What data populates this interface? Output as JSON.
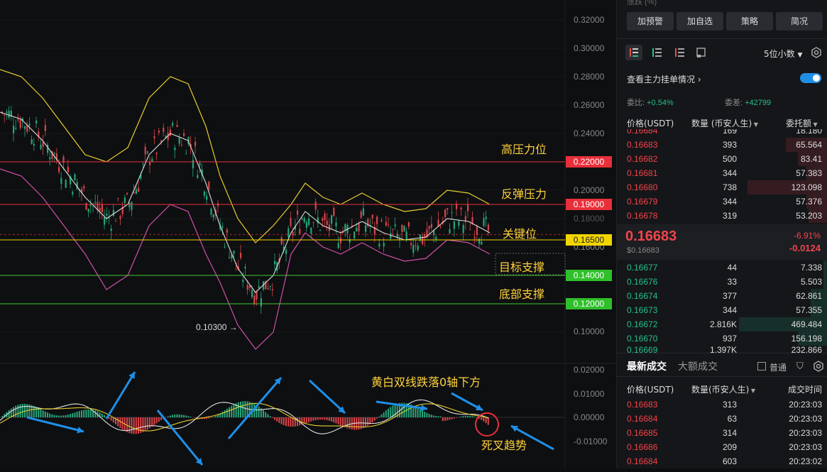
{
  "chart": {
    "price_axis": [
      "0.32000",
      "0.30000",
      "0.28000",
      "0.26000",
      "0.24000",
      "0.20000",
      "0.18000",
      "0.16000",
      "0.10000"
    ],
    "macd_axis": [
      "0.02000",
      "0.01000",
      "0.00000",
      "-0.01000"
    ],
    "levels": [
      {
        "price": "0.22000",
        "label": "高压力位",
        "color": "#e8303a"
      },
      {
        "price": "0.19000",
        "label": "反弹压力",
        "color": "#e8303a"
      },
      {
        "price": "0.16500",
        "label": "关键位",
        "color": "#f2d500"
      },
      {
        "price": "0.14000",
        "label": "目标支撑",
        "color": "#3ecb2f"
      },
      {
        "price": "0.12000",
        "label": "底部支撑",
        "color": "#3ecb2f"
      }
    ],
    "low_label": "0.10300",
    "macd_note": "黄白双线跌落0轴下方",
    "cross_note": "死叉趋势"
  },
  "panel": {
    "top_partial": "涨跌 (%)",
    "buttons": [
      "加预警",
      "加自选",
      "策略",
      "简况"
    ],
    "decimals": "5位小数",
    "depth_link": "查看主力挂单情况",
    "ratio_label": "委比:",
    "ratio_value": "+0.54%",
    "diff_label": "委差:",
    "diff_value": "+42799",
    "headers": {
      "price": "价格(USDT)",
      "qty": "数量 (币安人生)",
      "total": "委托额"
    },
    "asks_partial": {
      "price": "0.16684",
      "qty": "169",
      "total": "18.180"
    },
    "asks": [
      {
        "price": "0.16683",
        "qty": "393",
        "total": "65.564",
        "depth": 0.2
      },
      {
        "price": "0.16682",
        "qty": "500",
        "total": "83.41",
        "depth": 0.14
      },
      {
        "price": "0.16681",
        "qty": "344",
        "total": "57.383",
        "depth": 0.1
      },
      {
        "price": "0.16680",
        "qty": "738",
        "total": "123.098",
        "depth": 0.38
      },
      {
        "price": "0.16679",
        "qty": "344",
        "total": "57.376",
        "depth": 0.1
      },
      {
        "price": "0.16678",
        "qty": "319",
        "total": "53.203",
        "depth": 0.09
      }
    ],
    "last_price": "0.16683",
    "last_usd": "$0.16683",
    "change_pct": "-6.91%",
    "change_abs": "-0.0124",
    "bids": [
      {
        "price": "0.16677",
        "qty": "44",
        "total": "7.338",
        "depth": 0.02
      },
      {
        "price": "0.16676",
        "qty": "33",
        "total": "5.503",
        "depth": 0.02
      },
      {
        "price": "0.16674",
        "qty": "377",
        "total": "62.861",
        "depth": 0.08
      },
      {
        "price": "0.16673",
        "qty": "344",
        "total": "57.355",
        "depth": 0.08
      },
      {
        "price": "0.16672",
        "qty": "2.816K",
        "total": "469.484",
        "depth": 0.42
      },
      {
        "price": "0.16670",
        "qty": "937",
        "total": "156.198",
        "depth": 0.14
      }
    ],
    "bids_partial": {
      "price": "0.16669",
      "qty": "1.397K",
      "total": "232.866"
    },
    "trade_tabs": [
      "最新成交",
      "大额成交"
    ],
    "normal_label": "普通",
    "trade_headers": {
      "price": "价格(USDT)",
      "qty": "数量(币安人生)",
      "time": "成交时间"
    },
    "trades": [
      {
        "price": "0.16683",
        "qty": "313",
        "time": "20:23:03"
      },
      {
        "price": "0.16684",
        "qty": "63",
        "time": "20:23:03"
      },
      {
        "price": "0.16685",
        "qty": "314",
        "time": "20:23:03"
      },
      {
        "price": "0.16686",
        "qty": "209",
        "time": "20:23:03"
      },
      {
        "price": "0.16684",
        "qty": "603",
        "time": "20:23:02"
      }
    ]
  }
}
